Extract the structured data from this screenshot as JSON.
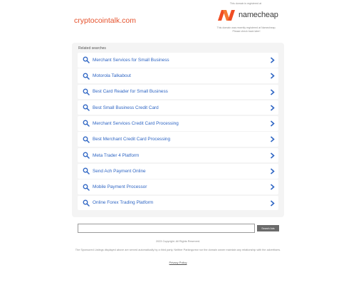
{
  "domain": "cryptocointalk.com",
  "registrar": {
    "note": "This domain is registered at",
    "logo_text": "namecheap",
    "subtext_line1": "This domain was recently registered at Namecheap.",
    "subtext_line2": "Please check back later!",
    "brand_color": "#f04d23"
  },
  "panel": {
    "heading": "Related searches",
    "items": [
      {
        "label": "Merchant Services for Small Business"
      },
      {
        "label": "Motorola Talkabout"
      },
      {
        "label": "Best Card Reader for Small Business"
      },
      {
        "label": "Best Small Business Credit Card"
      },
      {
        "label": "Merchant Services Credit Card Processing"
      },
      {
        "label": "Best Merchant Credit Card Processing"
      },
      {
        "label": "Meta Trader 4 Platform"
      },
      {
        "label": "Send Ach Payment Online"
      },
      {
        "label": "Mobile Payment Processor"
      },
      {
        "label": "Online Forex Trading Platform"
      }
    ]
  },
  "search": {
    "placeholder": "",
    "button_label": "Search Ads"
  },
  "footer": {
    "copyright": "2023 Copyright. All Rights Reserved.",
    "disclaimer": "The Sponsored Listings displayed above are served automatically by a third party. Neither Parkingcrew nor the domain owner maintain any relationship with the advertisers.",
    "privacy_label": "Privacy Policy"
  }
}
